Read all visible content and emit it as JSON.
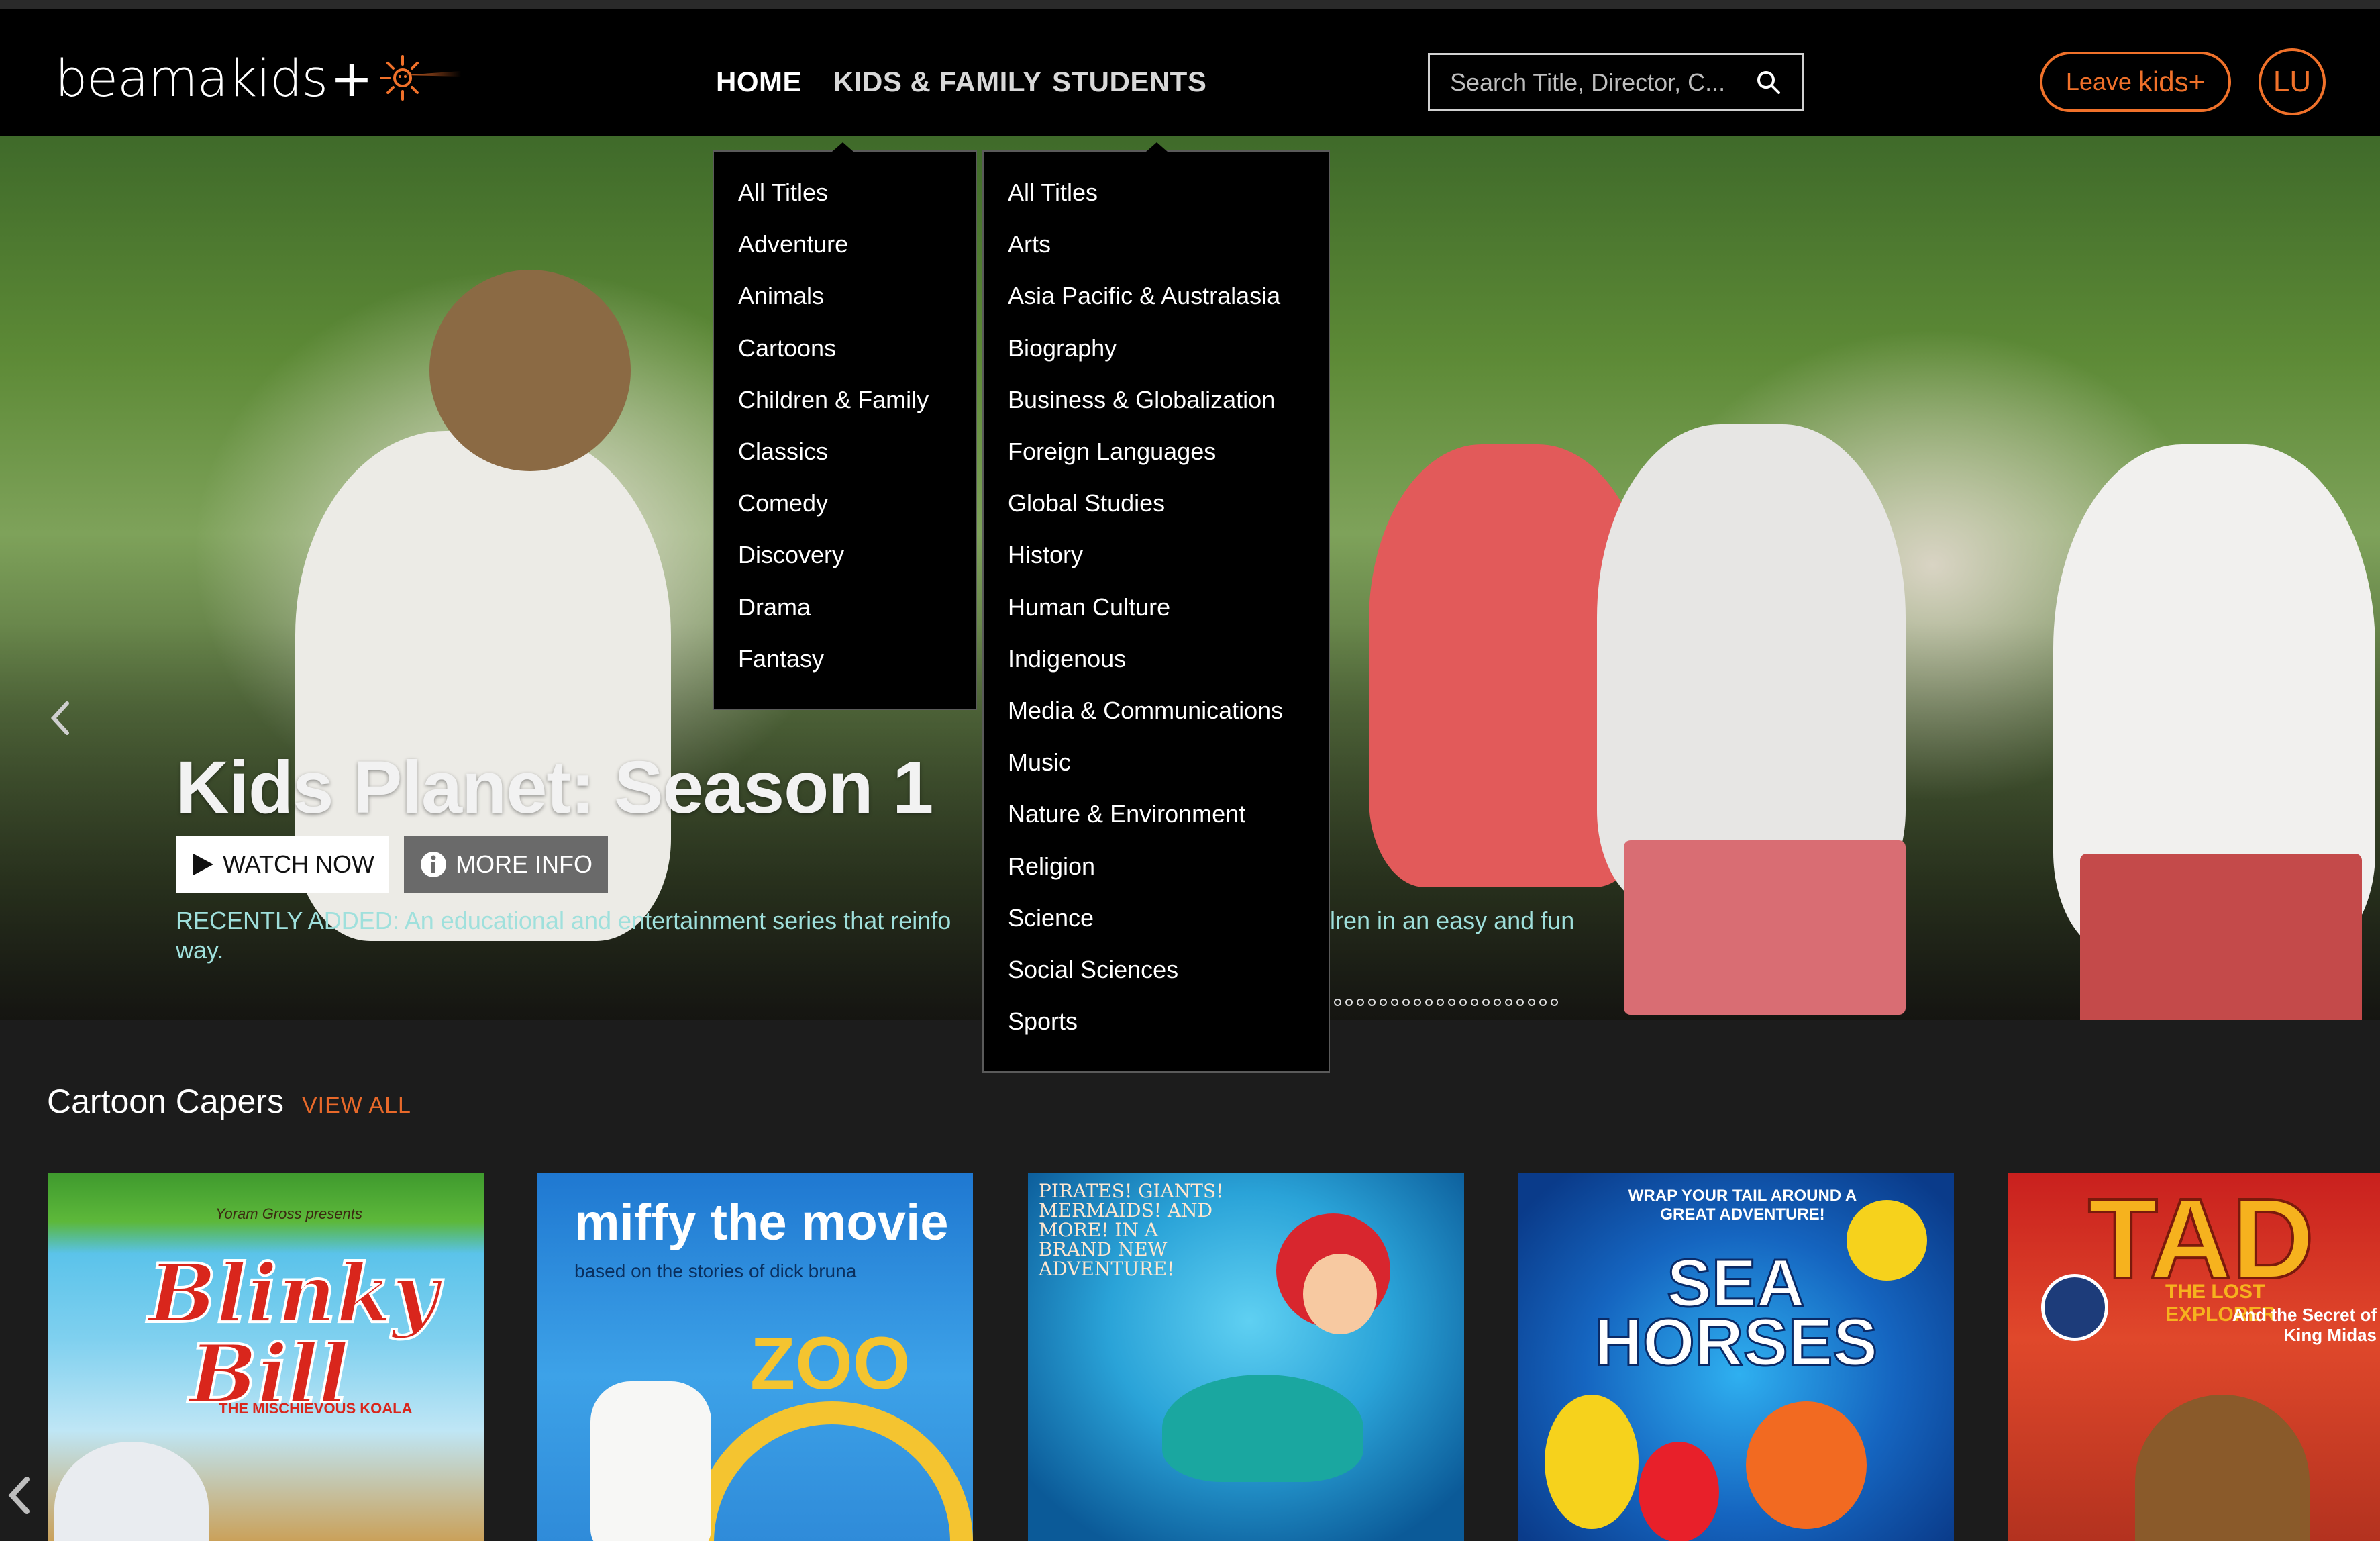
{
  "brand": {
    "logo_text": "beamakids",
    "logo_plus": "+"
  },
  "nav": {
    "home": "HOME",
    "kids_family": "KIDS & FAMILY",
    "students": "STUDENTS"
  },
  "search": {
    "placeholder": "Search Title, Director, C..."
  },
  "leave_button": {
    "prefix": "Leave",
    "suffix": "kids+"
  },
  "user": {
    "initials": "LU"
  },
  "kids_family_menu": [
    "All Titles",
    "Adventure",
    "Animals",
    "Cartoons",
    "Children & Family",
    "Classics",
    "Comedy",
    "Discovery",
    "Drama",
    "Fantasy"
  ],
  "students_menu": [
    "All Titles",
    "Arts",
    "Asia Pacific & Australasia",
    "Biography",
    "Business & Globalization",
    "Foreign Languages",
    "Global Studies",
    "History",
    "Human Culture",
    "Indigenous",
    "Media & Communications",
    "Music",
    "Nature & Environment",
    "Religion",
    "Science",
    "Social Sciences",
    "Sports"
  ],
  "hero": {
    "title": "Kids Planet: Season 1",
    "watch_label": "WATCH NOW",
    "info_label": "MORE INFO",
    "description_left": "RECENTLY ADDED: An educational and entertainment series that reinfo",
    "description_right": "lren in an easy and fun",
    "description_end": "way.",
    "slide_count": 20
  },
  "section": {
    "title": "Cartoon Capers",
    "view_all": "VIEW ALL"
  },
  "posters": [
    {
      "title": "Blinky Bill",
      "kicker": "Yoram Gross presents",
      "subtitle": "THE MISCHIEVOUS KOALA"
    },
    {
      "title": "miffy the movie",
      "subtitle": "based on the stories of dick bruna",
      "extra": "ZOO"
    },
    {
      "tagline": "PIRATES! GIANTS! MERMAIDS! AND MORE! IN A BRAND NEW ADVENTURE!"
    },
    {
      "tagline": "WRAP YOUR TAIL AROUND A GREAT ADVENTURE!",
      "title": "SEA HORSES"
    },
    {
      "title": "TAD",
      "subtitle": "THE LOST EXPLORER",
      "extra": "And the Secret of King Midas"
    }
  ],
  "colors": {
    "accent": "#f0712a",
    "teal_text": "#9fe0dc",
    "nav_bg": "#000000",
    "page_bg": "#1c1c1c"
  }
}
